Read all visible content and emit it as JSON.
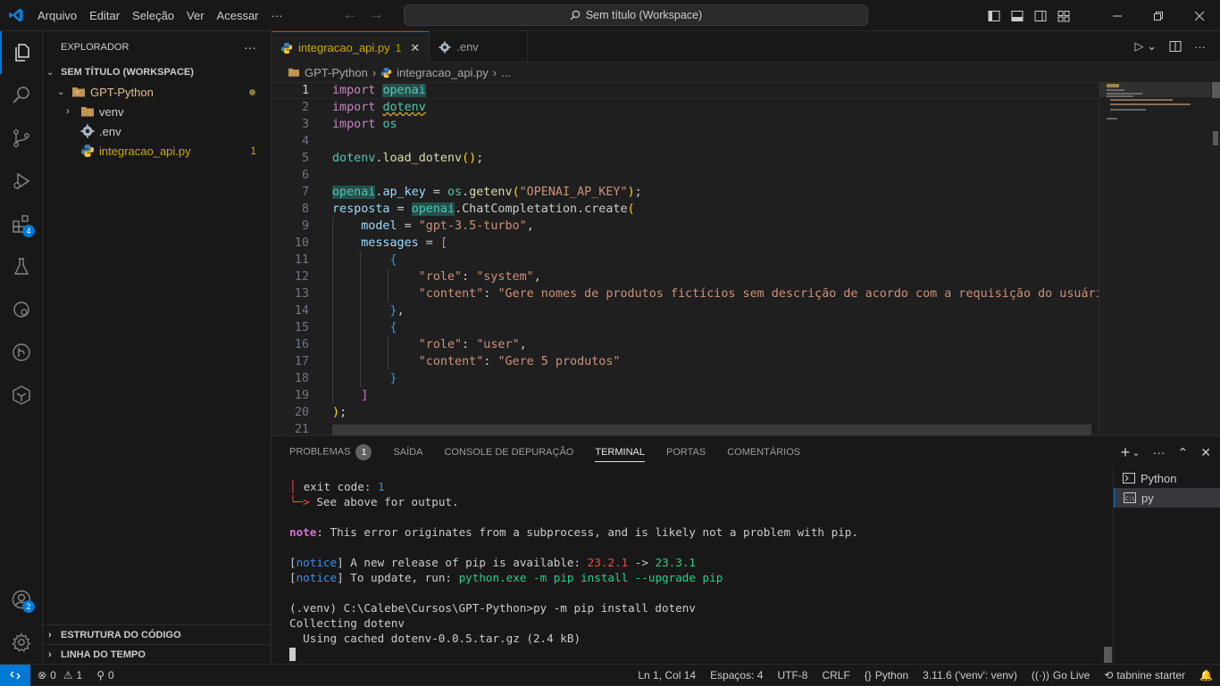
{
  "titlebar": {
    "menu": [
      "Arquivo",
      "Editar",
      "Seleção",
      "Ver",
      "Acessar",
      "···"
    ],
    "command_center": "Sem título (Workspace)"
  },
  "activity_bar": {
    "extensions_badge": "4",
    "accounts_badge": "2"
  },
  "sidebar": {
    "title": "EXPLORADOR",
    "more": "···",
    "workspace": "SEM TÍTULO (WORKSPACE)",
    "tree": [
      {
        "label": "GPT-Python"
      },
      {
        "label": "venv"
      },
      {
        "label": ".env"
      },
      {
        "label": "integracao_api.py",
        "problems": "1"
      }
    ],
    "sections": [
      "ESTRUTURA DO CÓDIGO",
      "LINHA DO TEMPO"
    ]
  },
  "tabs": [
    {
      "label": "integracao_api.py",
      "problems": "1"
    },
    {
      "label": ".env"
    }
  ],
  "breadcrumb": [
    "GPT-Python",
    "integracao_api.py",
    "..."
  ],
  "editor": {
    "line_numbers": [
      "1",
      "2",
      "3",
      "4",
      "5",
      "6",
      "7",
      "8",
      "9",
      "10",
      "11",
      "12",
      "13",
      "14",
      "15",
      "16",
      "17",
      "18",
      "19",
      "20",
      "21"
    ],
    "active_line": "1"
  },
  "panel": {
    "tabs": [
      "PROBLEMAS",
      "SAÍDA",
      "CONSOLE DE DEPURAÇÃO",
      "TERMINAL",
      "PORTAS",
      "COMENTÁRIOS"
    ],
    "problems_count": "1",
    "active_tab": "TERMINAL",
    "terminals": [
      "Python",
      "py"
    ],
    "terminal": {
      "exit_label": "exit code: ",
      "exit_code": "1",
      "see_above": "See above for output.",
      "note_label": "note",
      "note_text": ": This error originates from a subprocess, and is likely not a problem with pip.",
      "notice": "notice",
      "notice1_text": " A new release of pip is available: ",
      "old_version": "23.2.1",
      "arrow": " -> ",
      "new_version": "23.3.1",
      "notice2_text": " To update, run: ",
      "update_cmd": "python.exe -m pip install --upgrade pip",
      "prompt_line": "(.venv) C:\\Calebe\\Cursos\\GPT-Python>py -m pip install dotenv",
      "collecting": "Collecting dotenv",
      "using_cached": "  Using cached dotenv-0.0.5.tar.gz (2.4 kB)"
    }
  },
  "statusbar": {
    "errors": "0",
    "warnings": "1",
    "ports": "0",
    "position": "Ln 1, Col 14",
    "spaces": "Espaços: 4",
    "encoding": "UTF-8",
    "eol": "CRLF",
    "language": "Python",
    "interpreter": "3.11.6 ('venv': venv)",
    "golive": "Go Live",
    "tabnine": "tabnine starter"
  },
  "colors": {
    "accent": "#0078d4",
    "keyword": "#c586c0",
    "module": "#4ec9b0",
    "string": "#ce9178",
    "function": "#dcdcaa"
  }
}
